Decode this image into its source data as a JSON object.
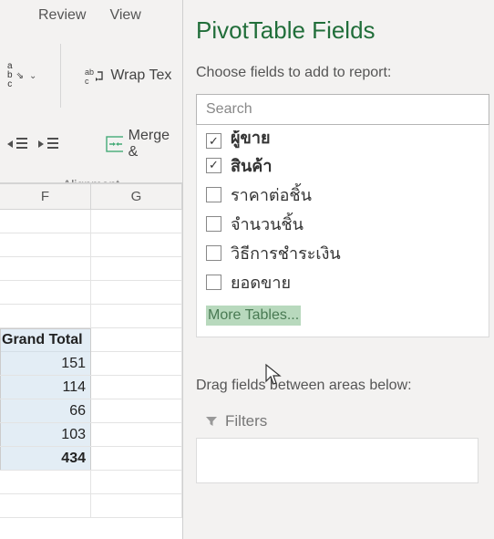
{
  "ribbon": {
    "tabs": [
      "Review",
      "View"
    ],
    "wrap_label": "Wrap Tex",
    "merge_label": "Merge &",
    "group_label": "Alignment"
  },
  "sheet": {
    "columns": [
      "F",
      "G"
    ],
    "grand_total_label": "Grand Total",
    "totals": [
      "151",
      "114",
      "66",
      "103",
      "434"
    ]
  },
  "pane": {
    "title": "PivotTable Fields",
    "subtitle": "Choose fields to add to report:",
    "search_placeholder": "Search",
    "fields": [
      {
        "label": "ผู้ขาย",
        "checked": true,
        "clipped": true,
        "bold": true
      },
      {
        "label": "สินค้า",
        "checked": true,
        "bold": true
      },
      {
        "label": "ราคาต่อชิ้น",
        "checked": false
      },
      {
        "label": "จำนวนชิ้น",
        "checked": false
      },
      {
        "label": "วิธีการชำระเงิน",
        "checked": false
      },
      {
        "label": "ยอดขาย",
        "checked": false
      }
    ],
    "more_tables": "More Tables...",
    "drag_label": "Drag fields between areas below:",
    "filters_label": "Filters"
  }
}
